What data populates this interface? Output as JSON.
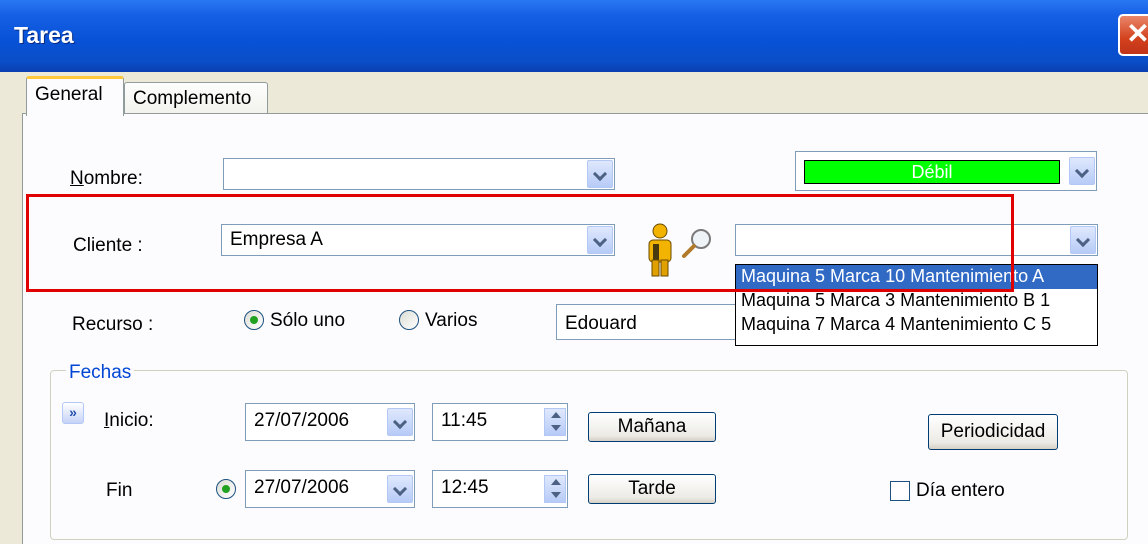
{
  "window": {
    "title": "Tarea"
  },
  "tabs": [
    {
      "label": "General",
      "active": true
    },
    {
      "label": "Complemento",
      "active": false
    }
  ],
  "form": {
    "nombre": {
      "label": "Nombre:",
      "value": ""
    },
    "strength": {
      "text": "Débil",
      "color": "#00ff00"
    },
    "cliente": {
      "label": "Cliente :",
      "value": "Empresa A"
    },
    "machine_combo": {
      "value": ""
    },
    "machine_options": [
      "Maquina 5 Marca 10 Mantenimiento A",
      "Maquina 5 Marca 3 Mantenimiento B 1",
      "Maquina 7 Marca 4 Mantenimiento C 5"
    ],
    "recurso": {
      "label": "Recurso :",
      "options": [
        "Sólo uno",
        "Varios"
      ],
      "selected": "Sólo uno",
      "value": "Edouard"
    }
  },
  "fechas": {
    "title": "Fechas",
    "inicio": {
      "label": "Inicio:",
      "date": "27/07/2006",
      "time": "11:45",
      "button": "Mañana"
    },
    "fin": {
      "label": "Fin",
      "date": "27/07/2006",
      "time": "12:45",
      "button": "Tarde"
    },
    "periodicidad": "Periodicidad",
    "dia_entero": {
      "label": "Día entero",
      "checked": false
    }
  },
  "colors": {
    "accent_red": "#e00000",
    "selection": "#316ac5",
    "title_bar": "#0852d8"
  }
}
